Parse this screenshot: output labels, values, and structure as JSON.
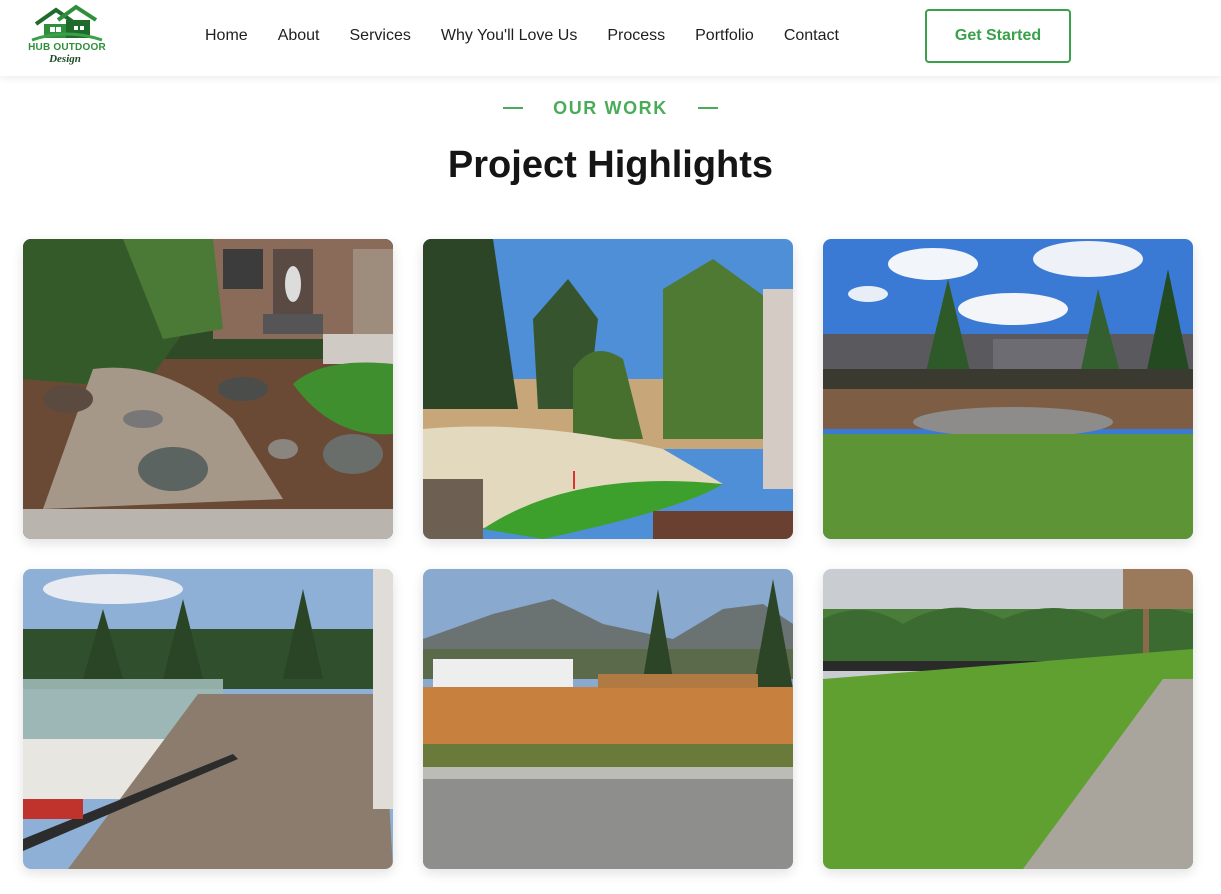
{
  "brand": {
    "line1": "HUB OUTDOOR",
    "line2": "Design",
    "logo_icon": "house-leaf-icon"
  },
  "nav": [
    "Home",
    "About",
    "Services",
    "Why You'll Love Us",
    "Process",
    "Portfolio",
    "Contact"
  ],
  "cta_label": "Get Started",
  "section": {
    "eyebrow": "OUR WORK",
    "title": "Project Highlights"
  },
  "gallery": [
    {
      "subject": "front-yard-rock-garden-photo"
    },
    {
      "subject": "backyard-putting-green-photo"
    },
    {
      "subject": "backyard-fire-pit-patio-photo"
    },
    {
      "subject": "composite-deck-glass-railing-photo"
    },
    {
      "subject": "cedar-fence-mountain-view-photo"
    },
    {
      "subject": "new-sod-lawn-photo"
    }
  ],
  "colors": {
    "accent": "#4aac58",
    "heading": "#151515",
    "nav_text": "#1f1f1f"
  }
}
